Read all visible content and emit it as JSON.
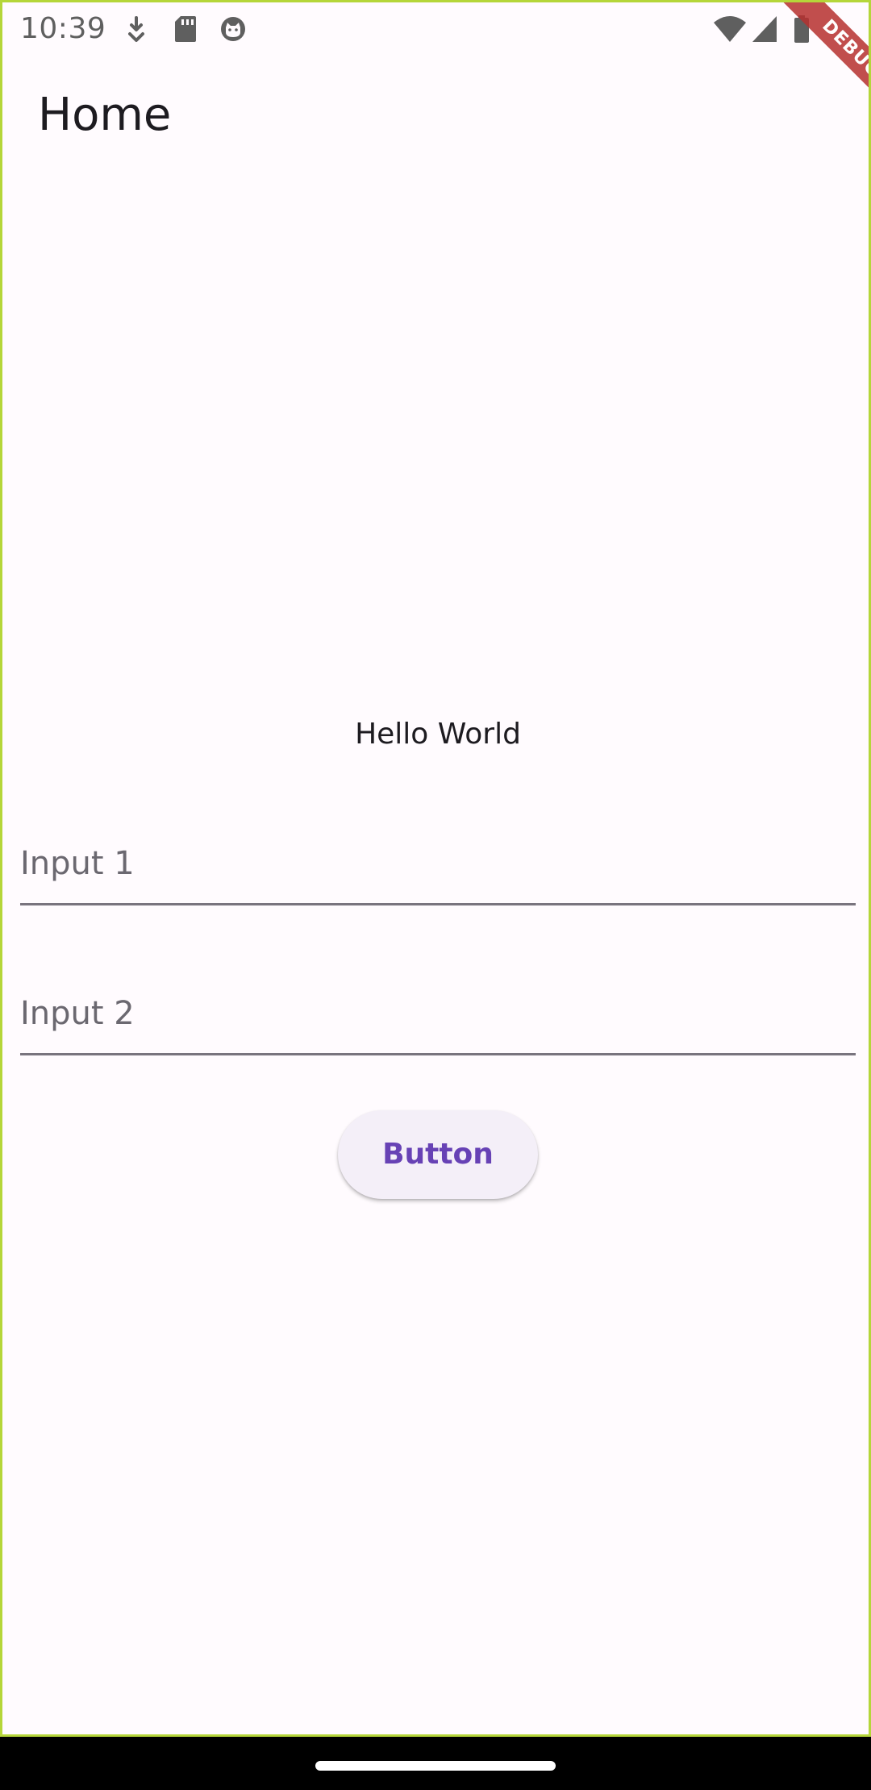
{
  "status_bar": {
    "time": "10:39",
    "left_icons": [
      "download-icon",
      "sd-card-icon",
      "cat-face-icon"
    ],
    "right_icons": [
      "wifi-icon",
      "cell-signal-icon",
      "battery-icon"
    ]
  },
  "app_bar": {
    "title": "Home"
  },
  "debug_banner": {
    "label": "DEBUG"
  },
  "content": {
    "greeting": "Hello World",
    "input_1": {
      "placeholder": "Input 1",
      "value": ""
    },
    "input_2": {
      "placeholder": "Input 2",
      "value": ""
    },
    "button_label": "Button"
  },
  "colors": {
    "background": "#fffbfe",
    "primary": "#6742b5",
    "button_bg": "#f4eff8",
    "text": "#1d1b20",
    "underline": "#79747e",
    "debug_banner": "#b7312f",
    "screen_border": "#b5d63a"
  }
}
